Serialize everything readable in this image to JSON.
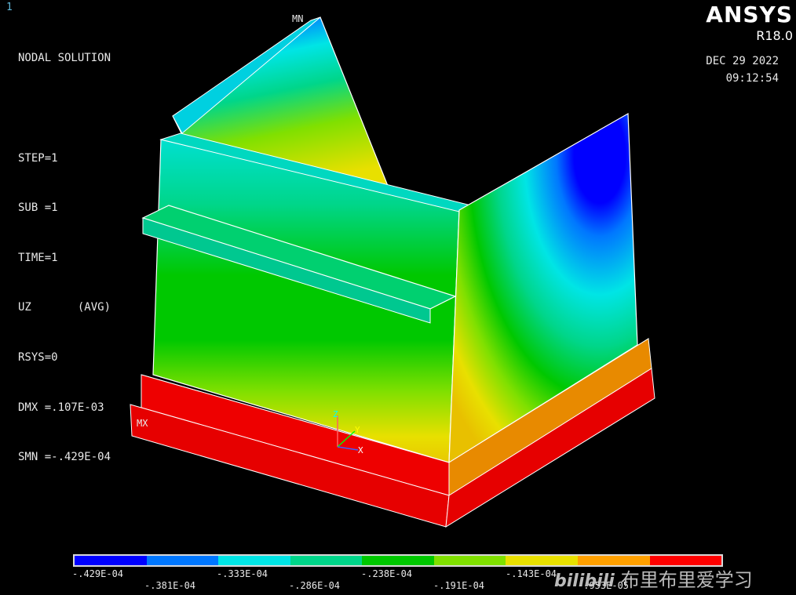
{
  "window": {
    "number": "1"
  },
  "info": {
    "lines": [
      "NODAL SOLUTION",
      "",
      "STEP=1",
      "SUB =1",
      "TIME=1",
      "UZ       (AVG)",
      "RSYS=0",
      "DMX =.107E-03",
      "SMN =-.429E-04"
    ]
  },
  "brand": {
    "name": "ANSYS",
    "version": "R18.0"
  },
  "datetime": {
    "date": "DEC 29 2022",
    "time": "09:12:54"
  },
  "labels": {
    "mn": "MN",
    "mx": "MX",
    "axis_z": "Z",
    "axis_y": "Y",
    "axis_x": "X"
  },
  "legend": {
    "colors": [
      "#0000ff",
      "#0077ff",
      "#00e5e5",
      "#00d68a",
      "#00c800",
      "#80e000",
      "#e8e000",
      "#ffa000",
      "#ff0000"
    ],
    "ticks_top": [
      "-.429E-04",
      "-.333E-04",
      "-.238E-04",
      "-.143E-04"
    ],
    "ticks_bottom": [
      "-.381E-04",
      "-.286E-04",
      "-.191E-04",
      "-.953E-05"
    ]
  },
  "watermark": {
    "logo": "bilibili",
    "text": "布里布里爱学习"
  }
}
